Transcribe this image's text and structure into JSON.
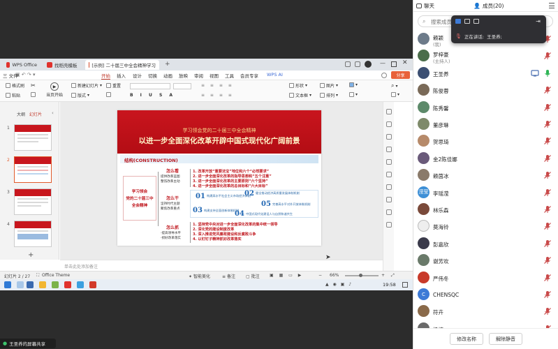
{
  "app": {
    "accent": "#2f6fe4",
    "mic_muted_color": "#c94a4a",
    "mic_active_color": "#2fb556"
  },
  "share": {
    "badge_text": "王圣养的屏幕共享"
  },
  "wps": {
    "tabs": [
      {
        "label": "WPS Office",
        "icon": "wps-logo-icon",
        "color": "#e0322d"
      },
      {
        "label": "找稻壳模板",
        "icon": "docer-icon",
        "color": "#e0322d"
      },
      {
        "label": "[示例] 二十届三中全会精神学习",
        "icon": "ppt-icon",
        "color": "#d24726"
      }
    ],
    "file_menu": "三 文件",
    "menus": [
      "开始",
      "插入",
      "设计",
      "切换",
      "动画",
      "放映",
      "审阅",
      "视图",
      "工具",
      "会员专享"
    ],
    "wps_ai": "WPS AI",
    "share_button": "分享",
    "ribbon": {
      "format_painter": "格式刷",
      "paste": "粘贴",
      "play_from_current": "当页开始",
      "new_slide": "新建幻灯片",
      "layout": "版式",
      "reset": "重置",
      "shape": "形状",
      "picture": "图片",
      "textbox": "文本框",
      "arrange": "排列"
    },
    "left_pane": {
      "tab_outline": "大纲",
      "tab_slides": "幻灯片",
      "slide_numbers": [
        "1",
        "2",
        "3",
        "4"
      ],
      "add_icon": "plus-icon"
    },
    "slide": {
      "subtitle": "学习领会党的二十届三中全会精神",
      "title": "以进一步全面深化改革开辟中国式现代化广阔前景",
      "structure_label": "结构(CONSTRUCTION)",
      "center_box": [
        "学习领会",
        "党的二十届三中",
        "全会精神"
      ],
      "how_see": "怎么看",
      "how_see_sub": [
        "提供改革蓝图",
        "整饬改革主动"
      ],
      "how_do": "怎么干",
      "how_do_sub": [
        "坚持时代主题",
        "聚焦改革重点"
      ],
      "how_grasp": "怎么抓",
      "how_grasp_sub": [
        "·提高领导水平",
        "·抓好改革落实"
      ],
      "points_top": [
        "1. 改革开放“重要法宝”地位和六个“必然要求”",
        "2. 进一步全面深化改革的指导思想和“五个注重”",
        "3. 进一步全面深化改革的主要原则“六个坚持”",
        "4. 进一步全面深化改革的总目标和“六大目标”"
      ],
      "numbered": [
        {
          "n": "01",
          "text": "构建高水平社会主义市场经济体制"
        },
        {
          "n": "02",
          "text": "健全推动经济高质量发展体制机制"
        },
        {
          "n": "03",
          "text": "构建支持全面创新体制机制"
        },
        {
          "n": "04",
          "text": "中国式现代化建设人与自然和谐共生"
        },
        {
          "n": "05",
          "text": "完善高水平对外开放体制机制"
        }
      ],
      "points_bottom": [
        "1. 坚持党中央对进一步全面深化改革的集中统一领导",
        "2. 深化党的建设制度改革",
        "3. 深入推进党风廉政建设和反腐败斗争",
        "4. 以钉钉子精神抓好改革落实"
      ]
    },
    "notes_placeholder": "单击此处添加备注",
    "status": {
      "slide_counter": "幻灯片 2 / 27",
      "theme": "Office Theme",
      "smart_beautify": "智能美化",
      "notes": "备注",
      "comments": "批注",
      "zoom": "66%"
    },
    "taskbar": {
      "time": "19:58"
    }
  },
  "speaker_popup": {
    "label": "正在讲话:",
    "name": "王圣养;"
  },
  "panel": {
    "chat_tab": "聊天",
    "members_tab": "成员(20)",
    "search_placeholder": "搜索成员",
    "members": [
      {
        "name": "赖颖",
        "sub": "(我)",
        "avatar_color": "#6d7b8a",
        "avatar_text": "",
        "mic": "muted",
        "cam": false
      },
      {
        "name": "罗梓豪",
        "sub": "(主持人)",
        "avatar_color": "#4a6d4a",
        "avatar_text": "",
        "mic": "muted",
        "cam": false
      },
      {
        "name": "王圣养",
        "sub": "",
        "avatar_color": "#3c4f72",
        "avatar_text": "",
        "mic": "active",
        "cam": true
      },
      {
        "name": "陈俊蓉",
        "sub": "",
        "avatar_color": "#7a6a58",
        "avatar_text": "",
        "mic": "muted",
        "cam": false
      },
      {
        "name": "陈秀馨",
        "sub": "",
        "avatar_color": "#5d8a6a",
        "avatar_text": "",
        "mic": "muted",
        "cam": false
      },
      {
        "name": "董彦琳",
        "sub": "",
        "avatar_color": "#7e8a6a",
        "avatar_text": "",
        "mic": "muted",
        "cam": false
      },
      {
        "name": "贺思琦",
        "sub": "",
        "avatar_color": "#b68a6a",
        "avatar_text": "",
        "mic": "muted",
        "cam": false
      },
      {
        "name": "金2陈佳娜",
        "sub": "",
        "avatar_color": "#6a5a7a",
        "avatar_text": "",
        "mic": "muted",
        "cam": false
      },
      {
        "name": "赖茵冰",
        "sub": "",
        "avatar_color": "#8a7a6a",
        "avatar_text": "",
        "mic": "muted",
        "cam": false
      },
      {
        "name": "李瑶滢",
        "sub": "",
        "avatar_color": "#3d8fd6",
        "avatar_text": "滢莹",
        "mic": "muted",
        "cam": false
      },
      {
        "name": "林乐森",
        "sub": "",
        "avatar_color": "#7a4a3a",
        "avatar_text": "",
        "mic": "muted",
        "cam": false
      },
      {
        "name": "莫海铃",
        "sub": "",
        "avatar_color": "#eeeeee",
        "avatar_text": "",
        "mic": "muted",
        "cam": false
      },
      {
        "name": "彭嘉欣",
        "sub": "",
        "avatar_color": "#3a3a4a",
        "avatar_text": "",
        "mic": "muted",
        "cam": false
      },
      {
        "name": "谢芳欢",
        "sub": "",
        "avatar_color": "#6a7a6a",
        "avatar_text": "",
        "mic": "muted",
        "cam": false
      },
      {
        "name": "严伟冬",
        "sub": "",
        "avatar_color": "#c83a2a",
        "avatar_text": "",
        "mic": "muted",
        "cam": false
      },
      {
        "name": "CHENSQC",
        "sub": "",
        "avatar_color": "#3d7ad6",
        "avatar_text": "C",
        "mic": "muted",
        "cam": false
      },
      {
        "name": "符卉",
        "sub": "",
        "avatar_color": "#8a6a4a",
        "avatar_text": "",
        "mic": "muted",
        "cam": false
      },
      {
        "name": "梁捷",
        "sub": "",
        "avatar_color": "#6a6a6a",
        "avatar_text": "",
        "mic": "muted",
        "cam": false
      }
    ],
    "rename_button": "修改名称",
    "unmute_all_button": "解除静音"
  }
}
